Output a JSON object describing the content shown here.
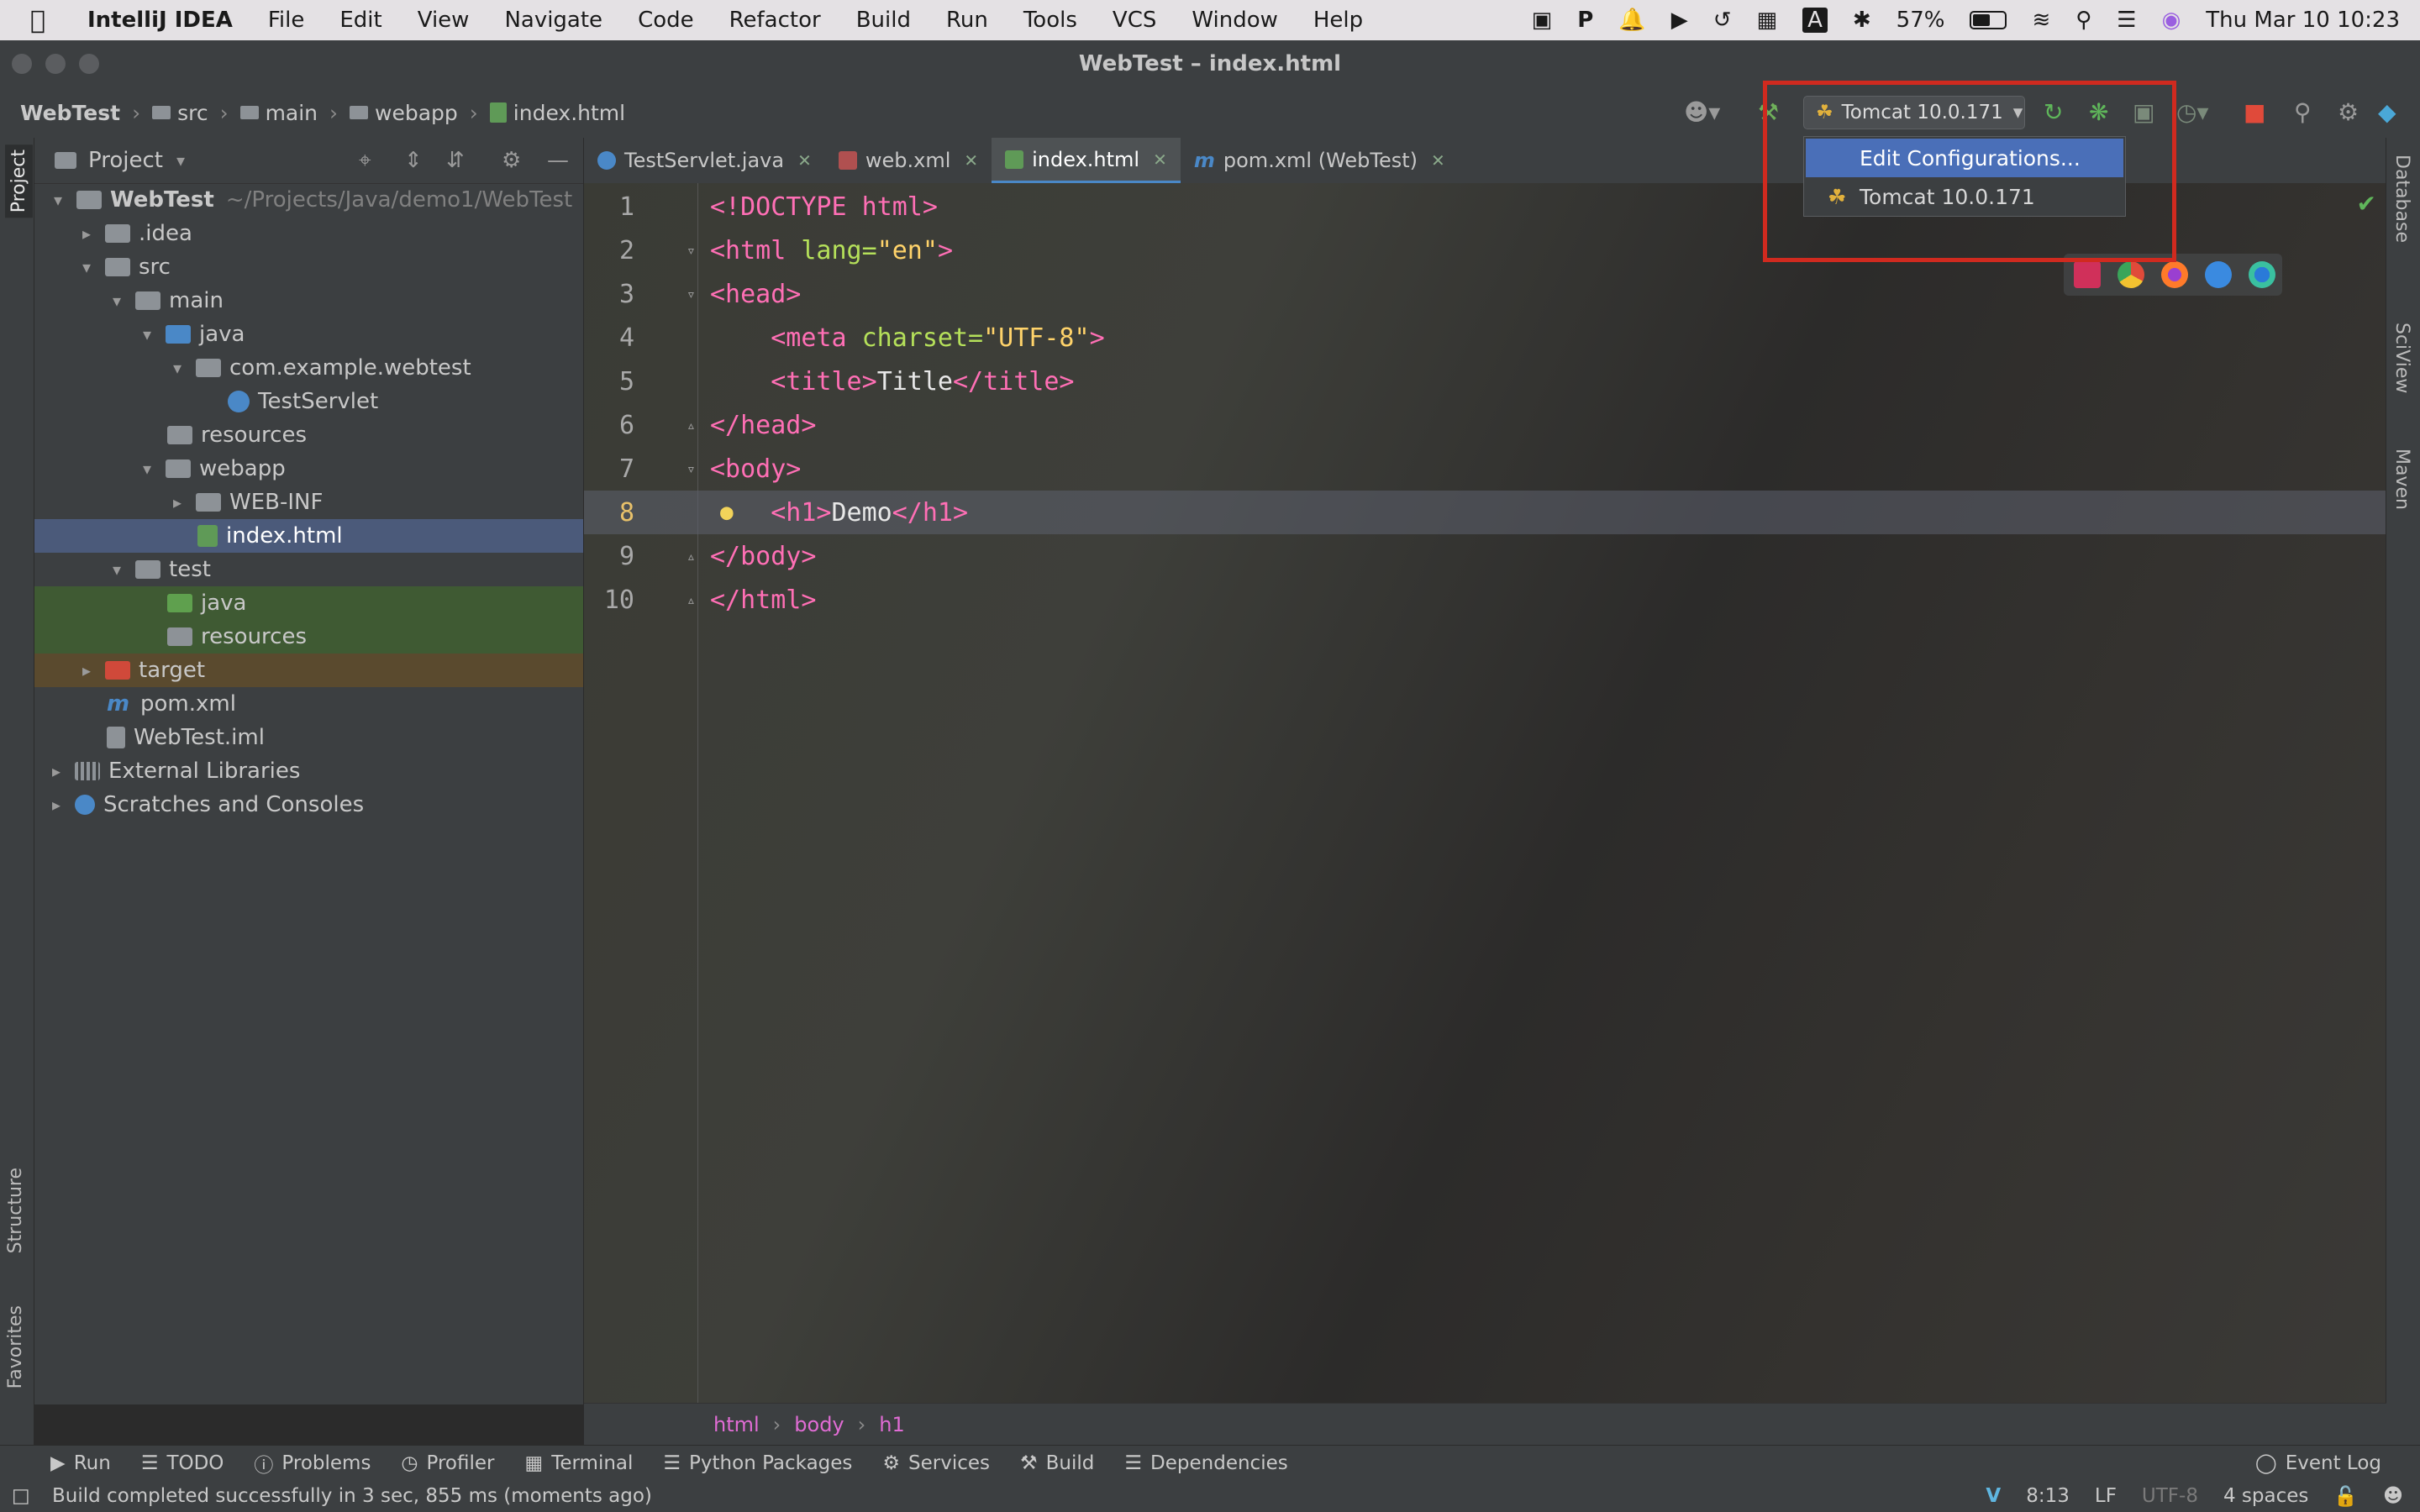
{
  "menubar": {
    "app": "IntelliJ IDEA",
    "items": [
      "File",
      "Edit",
      "View",
      "Navigate",
      "Code",
      "Refactor",
      "Build",
      "Run",
      "Tools",
      "VCS",
      "Window",
      "Help"
    ],
    "battery": "57%",
    "datetime": "Thu Mar 10  10:23"
  },
  "window": {
    "title": "WebTest – index.html"
  },
  "navbar": {
    "crumbs": [
      "WebTest",
      "src",
      "main",
      "webapp",
      "index.html"
    ],
    "run_config": "Tomcat 10.0.171"
  },
  "run_popup": {
    "items": [
      "Edit Configurations...",
      "Tomcat 10.0.171"
    ]
  },
  "project": {
    "title": "Project",
    "tree": [
      {
        "label": "WebTest",
        "path": "~/Projects/Java/demo1/WebTest"
      },
      {
        "label": ".idea"
      },
      {
        "label": "src"
      },
      {
        "label": "main"
      },
      {
        "label": "java"
      },
      {
        "label": "com.example.webtest"
      },
      {
        "label": "TestServlet"
      },
      {
        "label": "resources"
      },
      {
        "label": "webapp"
      },
      {
        "label": "WEB-INF"
      },
      {
        "label": "index.html"
      },
      {
        "label": "test"
      },
      {
        "label": "java"
      },
      {
        "label": "resources"
      },
      {
        "label": "target"
      },
      {
        "label": "pom.xml"
      },
      {
        "label": "WebTest.iml"
      },
      {
        "label": "External Libraries"
      },
      {
        "label": "Scratches and Consoles"
      }
    ]
  },
  "tabs": [
    "TestServlet.java",
    "web.xml",
    "index.html",
    "pom.xml (WebTest)"
  ],
  "editor": {
    "line_numbers": [
      "1",
      "2",
      "3",
      "4",
      "5",
      "6",
      "7",
      "8",
      "9",
      "10"
    ],
    "breadcrumbs": [
      "html",
      "body",
      "h1"
    ]
  },
  "left_strip": [
    "Project",
    "Structure",
    "Favorites"
  ],
  "right_strip": [
    "Database",
    "SciView",
    "Maven"
  ],
  "toolwindows": [
    "Run",
    "TODO",
    "Problems",
    "Profiler",
    "Terminal",
    "Python Packages",
    "Services",
    "Build",
    "Dependencies"
  ],
  "event_log": "Event Log",
  "status": {
    "message": "Build completed successfully in 3 sec, 855 ms (moments ago)",
    "position": "8:13",
    "line_sep": "LF",
    "encoding": "UTF-8",
    "indent": "4 spaces"
  }
}
